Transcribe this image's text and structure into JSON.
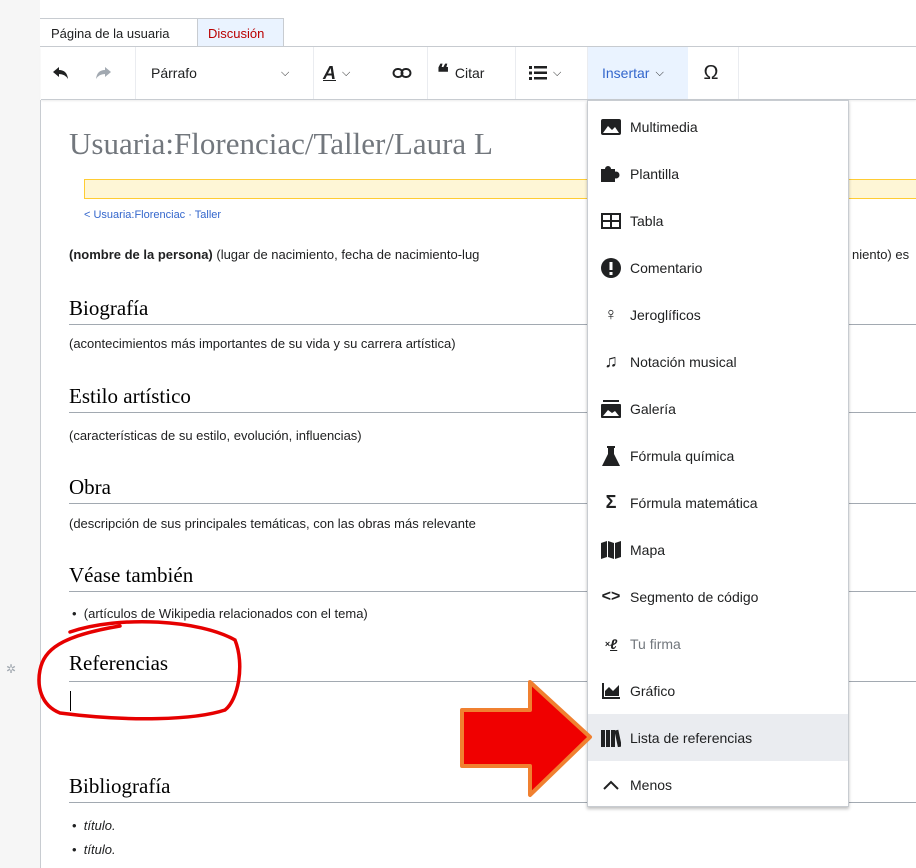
{
  "tabs": {
    "page": "Página de la usuaria",
    "discussion": "Discusión"
  },
  "toolbar": {
    "paragraph": "Párrafo",
    "cite": "Citar",
    "insert": "Insertar",
    "special_char": "Ω",
    "undo_icon": "undo-icon",
    "redo_icon": "redo-icon",
    "text_style_icon": "text-style-icon",
    "link_icon": "link-icon",
    "cite_icon": "quote-icon",
    "list_icon": "list-icon"
  },
  "page": {
    "title": "Usuaria:Florenciac/Taller/Laura L",
    "breadcrumb": "< Usuaria:Florenciac · Taller",
    "lead_bold": "(nombre de la persona)",
    "lead_rest": " (lugar de nacimiento, fecha de nacimiento-lug",
    "lead_right": "niento) es",
    "sections": [
      {
        "heading": "Biografía",
        "text": "(acontecimientos más importantes de su vida y su carrera artística)"
      },
      {
        "heading": "Estilo artístico",
        "text": "(características de su estilo, evolución, influencias)"
      },
      {
        "heading": "Obra",
        "text": "(descripción de sus principales temáticas, con las obras más relevante"
      },
      {
        "heading": "Véase también",
        "bullet": "(artículos de Wikipedia relacionados con el tema)"
      },
      {
        "heading": "Referencias"
      },
      {
        "heading": "Bibliografía",
        "bullets": [
          "título.",
          "título."
        ]
      }
    ]
  },
  "insert_menu": {
    "items": [
      {
        "label": "Multimedia",
        "icon": "image-icon"
      },
      {
        "label": "Plantilla",
        "icon": "puzzle-icon"
      },
      {
        "label": "Tabla",
        "icon": "table-icon"
      },
      {
        "label": "Comentario",
        "icon": "alert-icon"
      },
      {
        "label": "Jeroglíficos",
        "icon": "ankh-icon"
      },
      {
        "label": "Notación musical",
        "icon": "music-icon"
      },
      {
        "label": "Galería",
        "icon": "gallery-icon"
      },
      {
        "label": "Fórmula química",
        "icon": "flask-icon"
      },
      {
        "label": "Fórmula matemática",
        "icon": "sigma-icon"
      },
      {
        "label": "Mapa",
        "icon": "map-icon"
      },
      {
        "label": "Segmento de código",
        "icon": "code-icon"
      },
      {
        "label": "Tu firma",
        "icon": "signature-icon"
      },
      {
        "label": "Gráfico",
        "icon": "chart-icon"
      },
      {
        "label": "Lista de referencias",
        "icon": "references-icon"
      },
      {
        "label": "Menos",
        "icon": "chevron-up-icon"
      }
    ]
  },
  "colors": {
    "link": "#3366cc",
    "annotation_red": "#e60000",
    "arrow_fill": "#f00000",
    "arrow_stroke": "#f08030"
  }
}
